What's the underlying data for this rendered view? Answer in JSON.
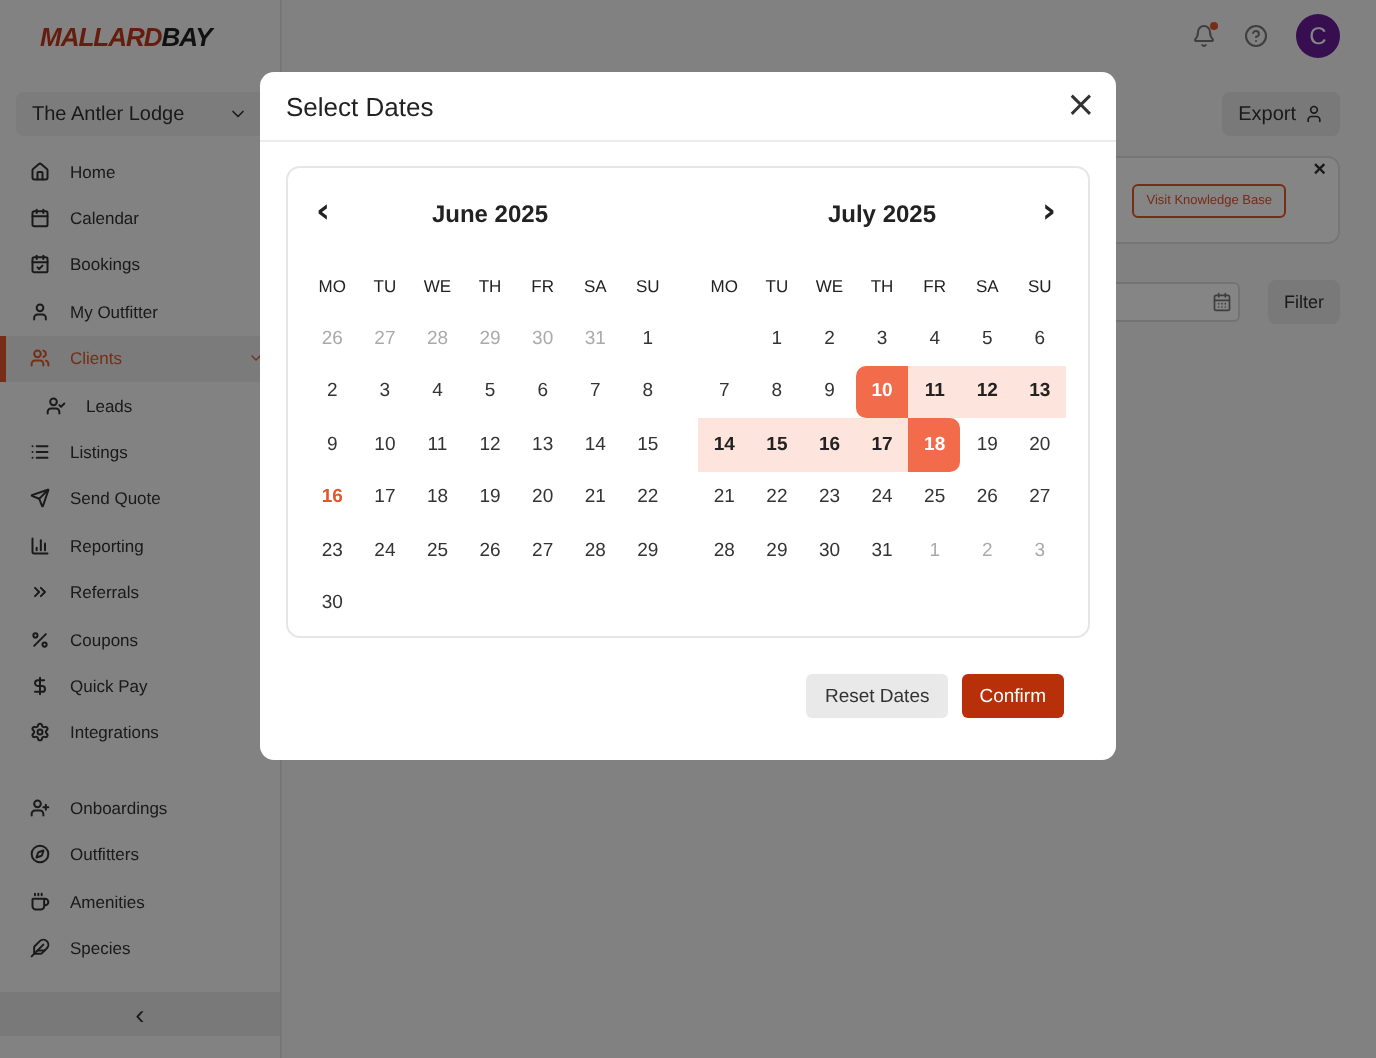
{
  "logo": {
    "first": "MALLARD",
    "second": "BAY"
  },
  "lodge_select": {
    "value": "The Antler Lodge"
  },
  "sidebar": {
    "items": [
      {
        "label": "Home",
        "selected": false
      },
      {
        "label": "Calendar",
        "selected": false
      },
      {
        "label": "Bookings",
        "selected": false
      },
      {
        "label": "My Outfitter",
        "selected": false
      },
      {
        "label": "Clients",
        "selected": true,
        "expanded": true,
        "children": [
          {
            "label": "Leads",
            "selected": false
          }
        ]
      },
      {
        "label": "Listings",
        "selected": false
      },
      {
        "label": "Send Quote",
        "selected": false
      },
      {
        "label": "Reporting",
        "selected": false
      },
      {
        "label": "Referrals",
        "selected": false
      },
      {
        "label": "Coupons",
        "selected": false
      },
      {
        "label": "Quick Pay",
        "selected": false
      },
      {
        "label": "Integrations",
        "selected": false
      }
    ],
    "admin_items": [
      {
        "label": "Onboardings",
        "selected": false
      },
      {
        "label": "Outfitters",
        "selected": false
      },
      {
        "label": "Amenities",
        "selected": false
      },
      {
        "label": "Species",
        "selected": false
      }
    ],
    "collapse": "‹"
  },
  "header": {
    "notification": true,
    "avatar": "C"
  },
  "toolbar": {
    "export": "Export"
  },
  "banner": {
    "link": "Visit Knowledge Base",
    "close": "×"
  },
  "filter_bar": {
    "filter": "Filter"
  },
  "dialog": {
    "title": "Select Dates",
    "close": "×",
    "prev": "‹",
    "next": "›",
    "months": [
      {
        "title": "June 2025",
        "weekdays": [
          "MO",
          "TU",
          "WE",
          "TH",
          "FR",
          "SA",
          "SU"
        ],
        "days": [
          {
            "label": "26",
            "kind": "outside"
          },
          {
            "label": "27",
            "kind": "outside"
          },
          {
            "label": "28",
            "kind": "outside"
          },
          {
            "label": "29",
            "kind": "outside"
          },
          {
            "label": "30",
            "kind": "outside"
          },
          {
            "label": "31",
            "kind": "outside"
          },
          {
            "label": "1",
            "kind": "day"
          },
          {
            "label": "2",
            "kind": "day"
          },
          {
            "label": "3",
            "kind": "day"
          },
          {
            "label": "4",
            "kind": "day"
          },
          {
            "label": "5",
            "kind": "day"
          },
          {
            "label": "6",
            "kind": "day"
          },
          {
            "label": "7",
            "kind": "day"
          },
          {
            "label": "8",
            "kind": "day"
          },
          {
            "label": "9",
            "kind": "day"
          },
          {
            "label": "10",
            "kind": "day"
          },
          {
            "label": "11",
            "kind": "day"
          },
          {
            "label": "12",
            "kind": "day"
          },
          {
            "label": "13",
            "kind": "day"
          },
          {
            "label": "14",
            "kind": "day"
          },
          {
            "label": "15",
            "kind": "day"
          },
          {
            "label": "16",
            "kind": "today"
          },
          {
            "label": "17",
            "kind": "day"
          },
          {
            "label": "18",
            "kind": "day"
          },
          {
            "label": "19",
            "kind": "day"
          },
          {
            "label": "20",
            "kind": "day"
          },
          {
            "label": "21",
            "kind": "day"
          },
          {
            "label": "22",
            "kind": "day"
          },
          {
            "label": "23",
            "kind": "day"
          },
          {
            "label": "24",
            "kind": "day"
          },
          {
            "label": "25",
            "kind": "day"
          },
          {
            "label": "26",
            "kind": "day"
          },
          {
            "label": "27",
            "kind": "day"
          },
          {
            "label": "28",
            "kind": "day"
          },
          {
            "label": "29",
            "kind": "day"
          },
          {
            "label": "30",
            "kind": "day"
          }
        ]
      },
      {
        "title": "July 2025",
        "weekdays": [
          "MO",
          "TU",
          "WE",
          "TH",
          "FR",
          "SA",
          "SU"
        ],
        "days": [
          {
            "kind": "blank"
          },
          {
            "label": "1",
            "kind": "day"
          },
          {
            "label": "2",
            "kind": "day"
          },
          {
            "label": "3",
            "kind": "day"
          },
          {
            "label": "4",
            "kind": "day"
          },
          {
            "label": "5",
            "kind": "day"
          },
          {
            "label": "6",
            "kind": "day"
          },
          {
            "label": "7",
            "kind": "day"
          },
          {
            "label": "8",
            "kind": "day"
          },
          {
            "label": "9",
            "kind": "day"
          },
          {
            "label": "10",
            "kind": "range_start"
          },
          {
            "label": "11",
            "kind": "in_range"
          },
          {
            "label": "12",
            "kind": "in_range"
          },
          {
            "label": "13",
            "kind": "in_range"
          },
          {
            "label": "14",
            "kind": "in_range"
          },
          {
            "label": "15",
            "kind": "in_range"
          },
          {
            "label": "16",
            "kind": "in_range"
          },
          {
            "label": "17",
            "kind": "in_range"
          },
          {
            "label": "18",
            "kind": "range_end"
          },
          {
            "label": "19",
            "kind": "day"
          },
          {
            "label": "20",
            "kind": "day"
          },
          {
            "label": "21",
            "kind": "day"
          },
          {
            "label": "22",
            "kind": "day"
          },
          {
            "label": "23",
            "kind": "day"
          },
          {
            "label": "24",
            "kind": "day"
          },
          {
            "label": "25",
            "kind": "day"
          },
          {
            "label": "26",
            "kind": "day"
          },
          {
            "label": "27",
            "kind": "day"
          },
          {
            "label": "28",
            "kind": "day"
          },
          {
            "label": "29",
            "kind": "day"
          },
          {
            "label": "30",
            "kind": "day"
          },
          {
            "label": "31",
            "kind": "day"
          },
          {
            "label": "1",
            "kind": "outside"
          },
          {
            "label": "2",
            "kind": "outside"
          },
          {
            "label": "3",
            "kind": "outside"
          }
        ]
      }
    ],
    "buttons": [
      {
        "label": "Reset Dates",
        "kind": "secondary"
      },
      {
        "label": "Confirm",
        "kind": "primary"
      }
    ]
  }
}
